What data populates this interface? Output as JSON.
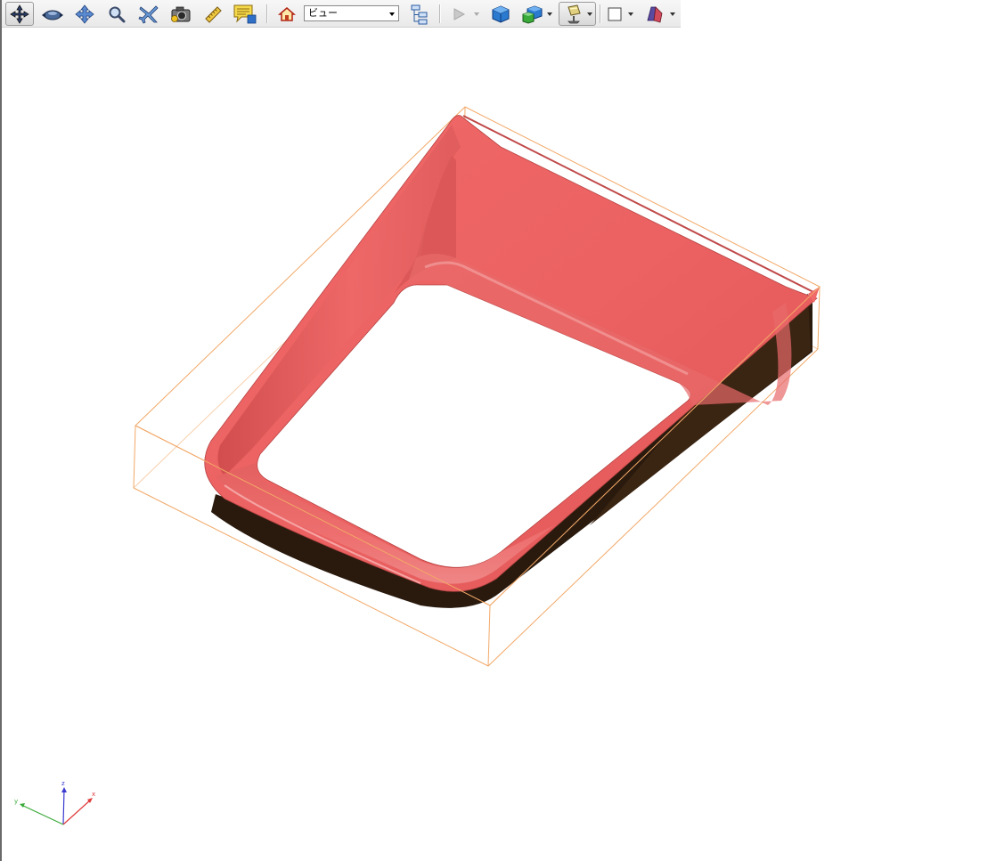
{
  "toolbar": {
    "tools": [
      {
        "name": "rotate",
        "icon": "rotate-icon",
        "active": true
      },
      {
        "name": "walk",
        "icon": "walk-icon"
      },
      {
        "name": "pan",
        "icon": "pan-icon"
      },
      {
        "name": "zoom",
        "icon": "zoom-icon"
      },
      {
        "name": "fly",
        "icon": "fly-icon"
      },
      {
        "name": "camera",
        "icon": "camera-icon"
      },
      {
        "name": "measure",
        "icon": "ruler-icon"
      },
      {
        "name": "comment",
        "icon": "comment-icon"
      },
      {
        "name": "home",
        "icon": "home-icon"
      },
      {
        "name": "model-tree",
        "icon": "model-tree-icon"
      },
      {
        "name": "play-animation",
        "icon": "play-icon",
        "disabled": true
      },
      {
        "name": "cube-solid",
        "icon": "solid-cube-icon"
      },
      {
        "name": "render-mode",
        "icon": "multi-cube-icon"
      },
      {
        "name": "lighting",
        "icon": "lighting-icon",
        "active": true
      },
      {
        "name": "background-color",
        "icon": "white-square-icon"
      },
      {
        "name": "cross-section",
        "icon": "cross-section-icon"
      }
    ],
    "view_select": {
      "selected": "ビュー"
    }
  },
  "colors": {
    "part_fill": "#e96262",
    "part_dark": "#2a1a0e",
    "bounding_box": "#f0a060",
    "axis_x": "#e03a3a",
    "axis_y": "#3aaa3a",
    "axis_z": "#3a3ad0"
  },
  "axis_triad": {
    "x_label": "x",
    "y_label": "y",
    "z_label": "z"
  }
}
